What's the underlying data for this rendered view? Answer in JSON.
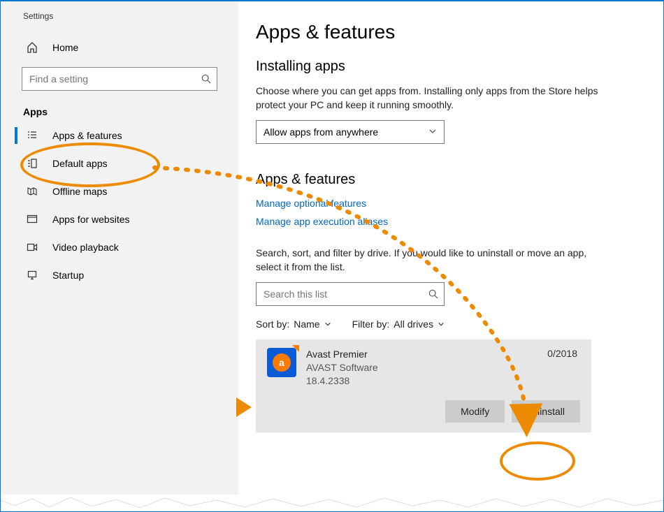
{
  "window": {
    "title": "Settings"
  },
  "sidebar": {
    "home": "Home",
    "search_placeholder": "Find a setting",
    "section": "Apps",
    "items": [
      {
        "label": "Apps & features"
      },
      {
        "label": "Default apps"
      },
      {
        "label": "Offline maps"
      },
      {
        "label": "Apps for websites"
      },
      {
        "label": "Video playback"
      },
      {
        "label": "Startup"
      }
    ]
  },
  "main": {
    "title": "Apps & features",
    "installing_heading": "Installing apps",
    "installing_desc": "Choose where you can get apps from. Installing only apps from the Store helps protect your PC and keep it running smoothly.",
    "installing_select": "Allow apps from anywhere",
    "apps_heading": "Apps & features",
    "link_optional": "Manage optional features",
    "link_aliases": "Manage app execution aliases",
    "search_desc": "Search, sort, and filter by drive. If you would like to uninstall or move an app, select it from the list.",
    "search_placeholder": "Search this list",
    "sort_label": "Sort by:",
    "sort_value": "Name",
    "filter_label": "Filter by:",
    "filter_value": "All drives",
    "app": {
      "name": "Avast Premier",
      "publisher": "AVAST Software",
      "version": "18.4.2338",
      "date": "0/2018",
      "icon_letter": "a"
    },
    "modify": "Modify",
    "uninstall": "Uninstall"
  },
  "annotation_colors": {
    "highlight": "#ed8b00"
  }
}
